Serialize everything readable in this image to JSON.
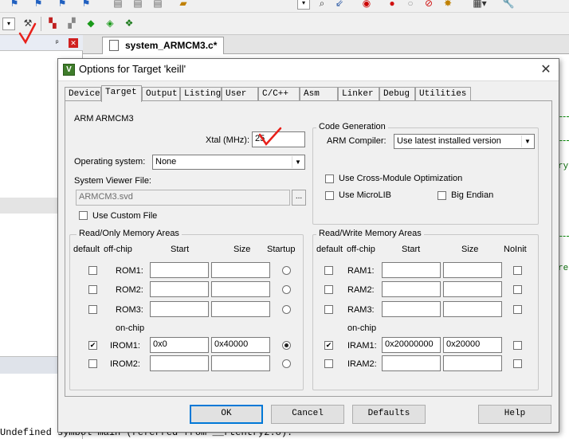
{
  "ide": {
    "editor_tab": "system_ARMCM3.c*",
    "right_snip_1": "ry",
    "right_snip_2": "re",
    "status_line": "Undefined symbol main (referred from __rtentry2.o)."
  },
  "dialog": {
    "title": "Options for Target 'keill'",
    "close": "✕",
    "tabs": [
      "Device",
      "Target",
      "Output",
      "Listing",
      "User",
      "C/C++",
      "Asm",
      "Linker",
      "Debug",
      "Utilities"
    ],
    "active_tab": "Target",
    "device_name": "ARM ARMCM3",
    "xtal_label": "Xtal (MHz):",
    "xtal_value": "25",
    "os_label": "Operating system:",
    "os_value": "None",
    "svd_label": "System Viewer File:",
    "svd_value": "ARMCM3.svd",
    "svd_browse": "...",
    "custom_file_label": "Use Custom File",
    "code_gen": {
      "title": "Code Generation",
      "compiler_label": "ARM Compiler:",
      "compiler_value": "Use latest installed version",
      "cross_module": "Use Cross-Module Optimization",
      "microlib": "Use MicroLIB",
      "big_endian": "Big Endian"
    },
    "rom": {
      "title": "Read/Only Memory Areas",
      "headers": [
        "default",
        "off-chip",
        "Start",
        "Size",
        "Startup"
      ],
      "on_chip": "on-chip",
      "rows": [
        {
          "label": "ROM1:",
          "start": "",
          "size": "",
          "default": false,
          "startup": false
        },
        {
          "label": "ROM2:",
          "start": "",
          "size": "",
          "default": false,
          "startup": false
        },
        {
          "label": "ROM3:",
          "start": "",
          "size": "",
          "default": false,
          "startup": false
        },
        {
          "label": "IROM1:",
          "start": "0x0",
          "size": "0x40000",
          "default": true,
          "startup": true
        },
        {
          "label": "IROM2:",
          "start": "",
          "size": "",
          "default": false,
          "startup": false
        }
      ]
    },
    "ram": {
      "title": "Read/Write Memory Areas",
      "headers": [
        "default",
        "off-chip",
        "Start",
        "Size",
        "NoInit"
      ],
      "on_chip": "on-chip",
      "rows": [
        {
          "label": "RAM1:",
          "start": "",
          "size": "",
          "default": false
        },
        {
          "label": "RAM2:",
          "start": "",
          "size": "",
          "default": false
        },
        {
          "label": "RAM3:",
          "start": "",
          "size": "",
          "default": false
        },
        {
          "label": "IRAM1:",
          "start": "0x20000000",
          "size": "0x20000",
          "default": true
        },
        {
          "label": "IRAM2:",
          "start": "",
          "size": "",
          "default": false
        }
      ]
    },
    "buttons": {
      "ok": "OK",
      "cancel": "Cancel",
      "defaults": "Defaults",
      "help": "Help"
    }
  },
  "colors": {
    "annotation_red": "#e8201a",
    "accent_blue": "#0078d7"
  }
}
